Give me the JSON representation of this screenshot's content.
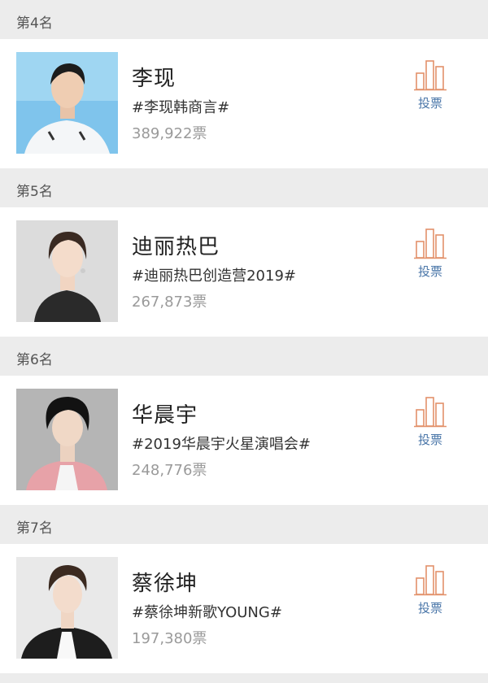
{
  "entries": [
    {
      "rank_label": "第4名",
      "name": "李现",
      "topic": "#李现韩商言#",
      "votes": "389,922票",
      "vote_label": "投票",
      "avatar_bg": "#7fc4ec"
    },
    {
      "rank_label": "第5名",
      "name": "迪丽热巴",
      "topic": "#迪丽热巴创造营2019#",
      "votes": "267,873票",
      "vote_label": "投票",
      "avatar_bg": "#dcdcdc"
    },
    {
      "rank_label": "第6名",
      "name": "华晨宇",
      "topic": "#2019华晨宇火星演唱会#",
      "votes": "248,776票",
      "vote_label": "投票",
      "avatar_bg": "#b5b5b5"
    },
    {
      "rank_label": "第7名",
      "name": "蔡徐坤",
      "topic": "#蔡徐坤新歌YOUNG#",
      "votes": "197,380票",
      "vote_label": "投票",
      "avatar_bg": "#e9e9e9"
    }
  ],
  "colors": {
    "vote_icon": "#e2916a",
    "vote_text": "#4a76a8",
    "votes_text": "#9a9a9a"
  },
  "icons": {
    "vote": "bar-chart-icon"
  }
}
